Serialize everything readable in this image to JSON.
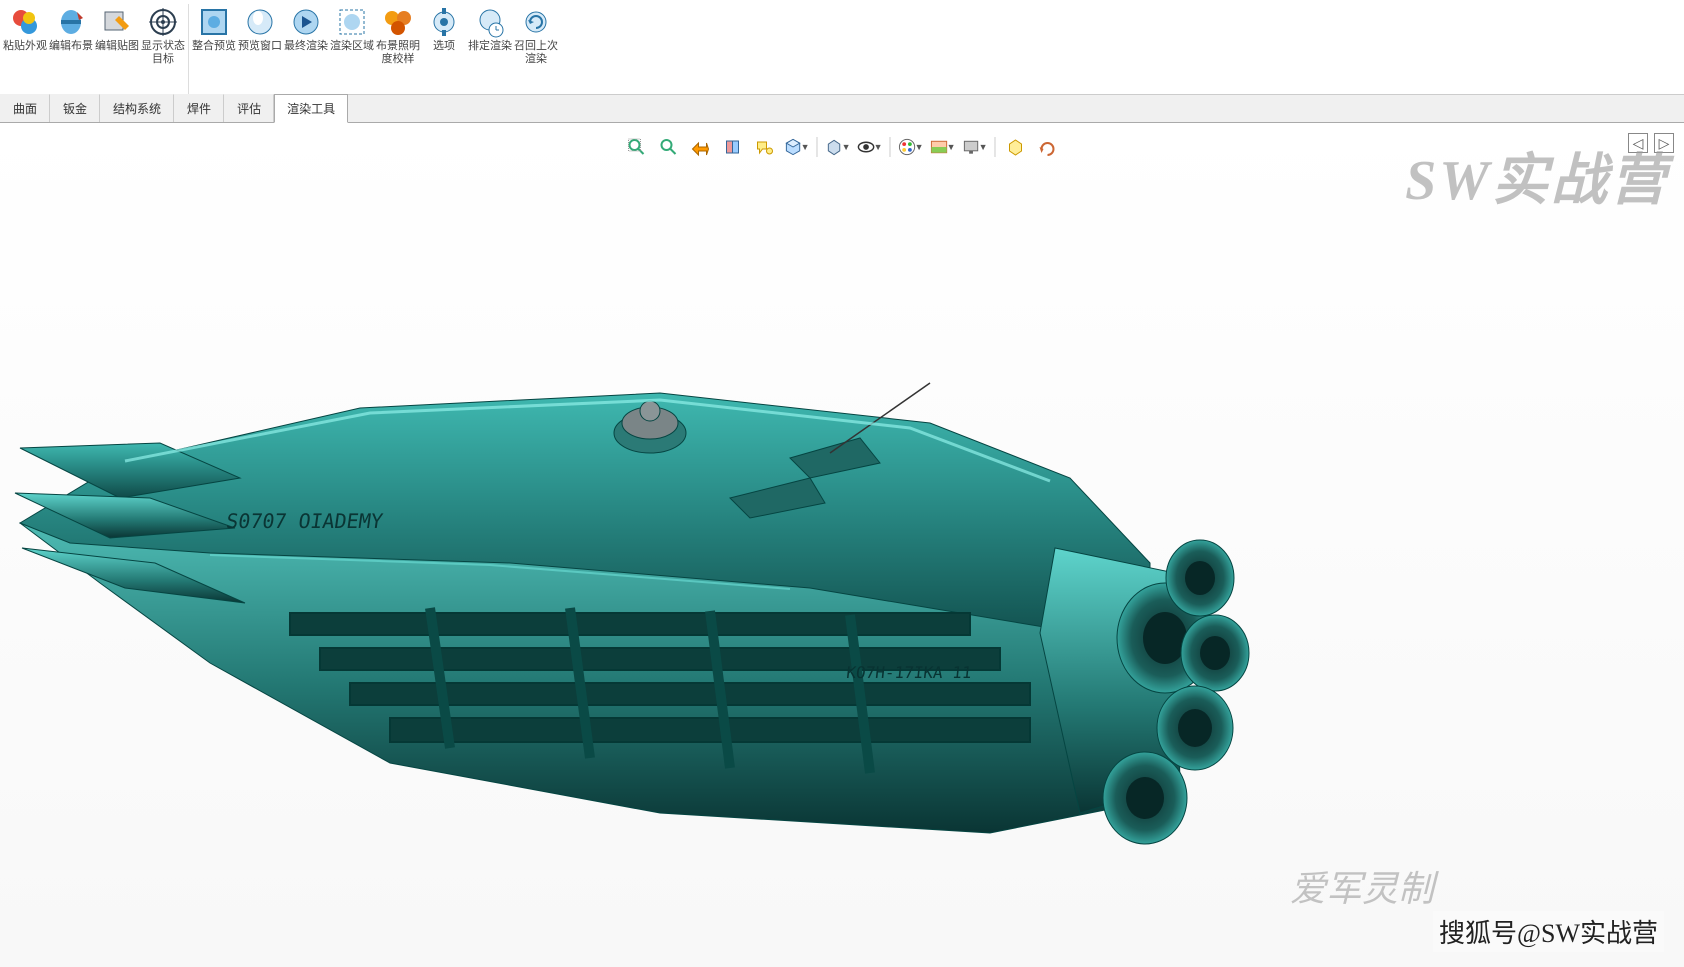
{
  "toolbar": {
    "items": [
      {
        "icon": "paste-ext",
        "label": "粘贴外观"
      },
      {
        "icon": "edit-scene",
        "label": "编辑布景"
      },
      {
        "icon": "edit-decal",
        "label": "编辑贴图"
      },
      {
        "icon": "show-state",
        "label": "显示状态目标"
      },
      {
        "icon": "integrated",
        "label": "整合预览"
      },
      {
        "icon": "preview-win",
        "label": "预览窗口"
      },
      {
        "icon": "final-render",
        "label": "最终渲染"
      },
      {
        "icon": "render-region",
        "label": "渲染区域"
      },
      {
        "icon": "scene-light",
        "label": "布景照明度校样"
      },
      {
        "icon": "options",
        "label": "选项"
      },
      {
        "icon": "schedule",
        "label": "排定渲染"
      },
      {
        "icon": "recall",
        "label": "召回上次渲染"
      }
    ]
  },
  "tabs": [
    {
      "label": "曲面",
      "active": false
    },
    {
      "label": "钣金",
      "active": false
    },
    {
      "label": "结构系统",
      "active": false
    },
    {
      "label": "焊件",
      "active": false
    },
    {
      "label": "评估",
      "active": false
    },
    {
      "label": "渲染工具",
      "active": true
    }
  ],
  "viewport_toolbar": [
    {
      "icon": "zoom-fit",
      "dd": false
    },
    {
      "icon": "zoom-area",
      "dd": false
    },
    {
      "icon": "previous-view",
      "dd": false
    },
    {
      "icon": "section-view",
      "dd": false
    },
    {
      "icon": "dynamic-annotation",
      "dd": false
    },
    {
      "icon": "view-orientation",
      "dd": true
    },
    {
      "icon": "display-style",
      "dd": true
    },
    {
      "icon": "hide-show",
      "dd": true
    },
    {
      "icon": "edit-appearance",
      "dd": true
    },
    {
      "icon": "apply-scene",
      "dd": true
    },
    {
      "icon": "view-settings",
      "dd": true
    },
    {
      "icon": "render-tools",
      "dd": false
    },
    {
      "icon": "rotate-view",
      "dd": false
    }
  ],
  "watermarks": {
    "top_right": "SW实战营",
    "bottom_mid": "爱军灵制",
    "bottom_right": "搜狐号@SW实战营"
  },
  "model": {
    "hull_text_front": "S0707 OIADEMY",
    "hull_text_rear": "KO7H-17IKA 11"
  }
}
